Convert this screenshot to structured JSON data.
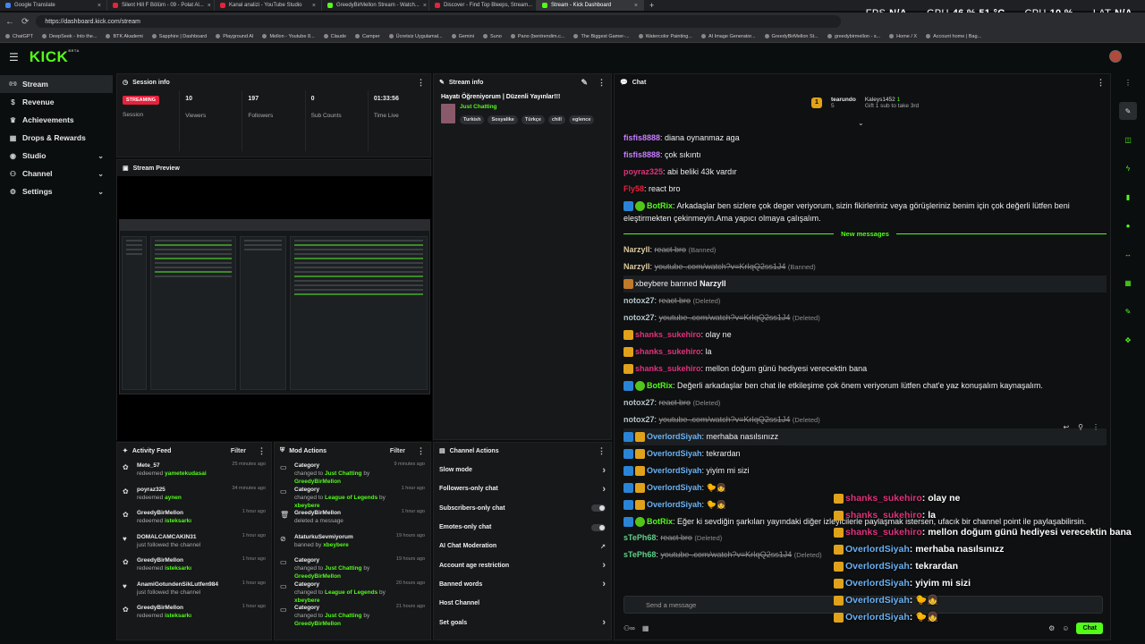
{
  "browser": {
    "tabs": [
      {
        "label": "Google Translate",
        "color": "#4285f4"
      },
      {
        "label": "Silent Hill F Bölüm - 09 - Polat Al...",
        "color": "#e8213d"
      },
      {
        "label": "Kanal analizi - YouTube Studio",
        "color": "#e8213d"
      },
      {
        "label": "GreedyBirMellon Stream - Watch...",
        "color": "#53fc18"
      },
      {
        "label": "Discover - Find Top Bleeps, Stream...",
        "color": "#e8213d"
      },
      {
        "label": "Stream - Kick Dashboard",
        "color": "#53fc18",
        "active": true
      }
    ],
    "new_tab": "+",
    "url": "https://dashboard.kick.com/stream",
    "bookmarks": [
      "ChatGPT",
      "DeepSeek - Into the...",
      "BTK Akademi",
      "Sapphire | Dashboard",
      "Playground AI",
      "Mellon - Youtube 8...",
      "Claude",
      "Camper",
      "Ücretsiz Uygulamal...",
      "Gemini",
      "Suno",
      "Pano (bentrendim.c...",
      "The Biggest Gamer-...",
      "Watercolor Painting...",
      "AI Image Generator...",
      "GreedyBirMellon St...",
      "greedybirmellon - s...",
      "Home / X",
      "Account home | Bag..."
    ]
  },
  "perf": {
    "fps_label": "FPS",
    "fps_value": "N/A",
    "gpu_label": "GPU",
    "gpu_value": "46 % 51 °C",
    "cpu_label": "CPU",
    "cpu_value": "10 %",
    "lat_label": "LAT",
    "lat_value": "N/A"
  },
  "header": {
    "logo": "KICK",
    "logo_beta": "BETA"
  },
  "sidebar": {
    "items": [
      {
        "label": "Stream",
        "icon": "broadcast-icon",
        "active": true
      },
      {
        "label": "Revenue",
        "icon": "dollar-icon"
      },
      {
        "label": "Achievements",
        "icon": "trophy-icon"
      },
      {
        "label": "Drops & Rewards",
        "icon": "gift-icon"
      },
      {
        "label": "Studio",
        "icon": "studio-icon",
        "chevron": true
      },
      {
        "label": "Channel",
        "icon": "user-icon",
        "chevron": true
      },
      {
        "label": "Settings",
        "icon": "gear-icon",
        "chevron": true
      }
    ]
  },
  "session": {
    "title": "Session info",
    "status": "STREAMING",
    "status_label": "Session",
    "viewers": "10",
    "viewers_label": "Viewers",
    "followers": "197",
    "followers_label": "Followers",
    "subs": "0",
    "subs_label": "Sub Counts",
    "time": "01:33:56",
    "time_label": "Time Live"
  },
  "stream_info": {
    "title": "Stream info",
    "stream_title": "Hayatı Öğreniyorum | Düzenli Yayınlar!!!",
    "category": "Just Chatting",
    "tags": [
      "Turkish",
      "Sosyalike",
      "Türkçe",
      "chill",
      "eglence"
    ]
  },
  "preview": {
    "title": "Stream Preview"
  },
  "activity": {
    "title": "Activity Feed",
    "filter": "Filter",
    "items": [
      {
        "name": "Mete_57",
        "sub": "redeemed",
        "sub_acc": "yametekudasai",
        "time": "25 minutes ago",
        "icon": "redeem-icon"
      },
      {
        "name": "poyraz325",
        "sub": "redeemed",
        "sub_acc": "aynen",
        "time": "34 minutes ago",
        "icon": "redeem-icon"
      },
      {
        "name": "GreedyBirMellon",
        "sub": "redeemed",
        "sub_acc": "isteksarkı",
        "time": "1 hour ago",
        "icon": "redeem-icon"
      },
      {
        "name": "DOMALCAMCAKIN31",
        "sub": "just followed the channel",
        "sub_acc": "",
        "time": "1 hour ago",
        "icon": "heart-icon"
      },
      {
        "name": "GreedyBirMellon",
        "sub": "redeemed",
        "sub_acc": "isteksarkı",
        "time": "1 hour ago",
        "icon": "redeem-icon"
      },
      {
        "name": "AnamiGotundenSikLutfen984",
        "sub": "just followed the channel",
        "sub_acc": "",
        "time": "1 hour ago",
        "icon": "heart-icon"
      },
      {
        "name": "GreedyBirMellon",
        "sub": "redeemed",
        "sub_acc": "isteksarkı",
        "time": "1 hour ago",
        "icon": "redeem-icon"
      }
    ]
  },
  "mod": {
    "title": "Mod Actions",
    "filter": "Filter",
    "items": [
      {
        "name": "Category",
        "pre": "changed to",
        "a1": "Just Chatting",
        "mid": "by",
        "a2": "GreedyBirMellon",
        "time": "9 minutes ago",
        "icon": "category-icon"
      },
      {
        "name": "Category",
        "pre": "changed to",
        "a1": "League of Legends",
        "mid": "by",
        "a2": "xbeybere",
        "time": "1 hour ago",
        "icon": "category-icon"
      },
      {
        "name": "GreedyBirMellon",
        "pre": "deleted a message",
        "a1": "",
        "mid": "",
        "a2": "",
        "time": "1 hour ago",
        "icon": "trash-icon"
      },
      {
        "name": "AtaturkuSevmiyorum",
        "pre": "banned by",
        "a1": "xbeybere",
        "mid": "",
        "a2": "",
        "time": "19 hours ago",
        "icon": "ban-icon"
      },
      {
        "name": "Category",
        "pre": "changed to",
        "a1": "Just Chatting",
        "mid": "by",
        "a2": "GreedyBirMellon",
        "time": "19 hours ago",
        "icon": "category-icon"
      },
      {
        "name": "Category",
        "pre": "changed to",
        "a1": "League of Legends",
        "mid": "by",
        "a2": "xbeybere",
        "time": "20 hours ago",
        "icon": "category-icon"
      },
      {
        "name": "Category",
        "pre": "changed to",
        "a1": "Just Chatting",
        "mid": "by",
        "a2": "GreedyBirMellon",
        "time": "21 hours ago",
        "icon": "category-icon"
      }
    ]
  },
  "channel_actions": {
    "title": "Channel Actions",
    "items": [
      {
        "label": "Slow mode",
        "type": "chevron"
      },
      {
        "label": "Followers-only chat",
        "type": "chevron"
      },
      {
        "label": "Subscribers-only chat",
        "type": "toggle"
      },
      {
        "label": "Emotes-only chat",
        "type": "toggle"
      },
      {
        "label": "AI Chat Moderation",
        "type": "external"
      },
      {
        "label": "Account age restriction",
        "type": "chevron"
      },
      {
        "label": "Banned words",
        "type": "chevron"
      },
      {
        "label": "Host Channel",
        "type": "none"
      },
      {
        "label": "Set goals",
        "type": "chevron"
      }
    ]
  },
  "chat": {
    "title": "Chat",
    "gifter": "tearundo",
    "gifter_count": "5",
    "top2": "Kaleys1452",
    "top2_count": "1",
    "gift_text": "Gift 1 sub to take 3rd",
    "new_messages": "New messages",
    "input_placeholder": "Send a message",
    "send": "Chat",
    "messages": [
      {
        "user": "fisfis8888",
        "color": "#c77dff",
        "text": ": diana oynanmaz aga"
      },
      {
        "user": "fisfis8888",
        "color": "#c77dff",
        "text": ": çok sıkıntı"
      },
      {
        "user": "poyraz325",
        "color": "#e0327d",
        "text": ": abi beliki 43k vardır"
      },
      {
        "user": "Fly58",
        "color": "#e8213d",
        "text": ": react bro"
      },
      {
        "user": "BotRix",
        "color": "#53fc18",
        "icons": [
          "bot",
          "ver"
        ],
        "multi": true,
        "text": ": Arkadaşlar ben sizlere çok deger veriyorum, sizin fikirleriniz veya görüşleriniz benim için çok değerli lütfen beni eleştirmekten çekinmeyin.Ama yapıcı olmaya çalışalım."
      },
      {
        "divider": true
      },
      {
        "user": "Narzyll",
        "color": "#ddc9a0",
        "del": "react bro",
        "note": "(Banned)"
      },
      {
        "user": "Narzyll",
        "color": "#ddc9a0",
        "del": "youtube .com/watch?v=KrIqQ2ss1J4",
        "note": "(Banned)"
      },
      {
        "system": true,
        "pre": "xbeybere",
        "mid": " banned ",
        "post": "Narzyll"
      },
      {
        "user": "notox27",
        "color": "#b6c4c8",
        "del": "react bro",
        "note": "(Deleted)"
      },
      {
        "user": "notox27",
        "color": "#b6c4c8",
        "del": "youtube .com/watch?v=KrIqQ2ss1J4",
        "note": "(Deleted)"
      },
      {
        "user": "shanks_sukehiro",
        "color": "#e0327d",
        "icons": [
          "crown"
        ],
        "text": ": olay ne"
      },
      {
        "user": "shanks_sukehiro",
        "color": "#e0327d",
        "icons": [
          "crown"
        ],
        "text": ": la"
      },
      {
        "user": "shanks_sukehiro",
        "color": "#e0327d",
        "icons": [
          "crown"
        ],
        "text": ": mellon doğum günü hediyesi verecektin bana"
      },
      {
        "user": "BotRix",
        "color": "#53fc18",
        "icons": [
          "bot",
          "ver"
        ],
        "text": ": Değerli arkadaşlar ben chat ile etkileşime çok önem veriyorum lütfen chat'e yaz konuşalım kaynaşalım."
      },
      {
        "user": "notox27",
        "color": "#b6c4c8",
        "del": "react bro",
        "note": "(Deleted)"
      },
      {
        "user": "notox27",
        "color": "#b6c4c8",
        "del": "youtube .com/watch?v=KrIqQ2ss1J4",
        "note": "(Deleted)"
      },
      {
        "user": "OverlordSiyah",
        "color": "#6ab0f3",
        "icons": [
          "bot",
          "crown"
        ],
        "text": ": merhaba nasılsınızz",
        "hl": true
      },
      {
        "user": "OverlordSiyah",
        "color": "#6ab0f3",
        "icons": [
          "bot",
          "crown"
        ],
        "text": ": tekrardan"
      },
      {
        "user": "OverlordSiyah",
        "color": "#6ab0f3",
        "icons": [
          "bot",
          "crown"
        ],
        "text": ": yiyim mi sizi"
      },
      {
        "user": "OverlordSiyah",
        "color": "#6ab0f3",
        "icons": [
          "bot",
          "crown"
        ],
        "text": ": 🐤👧"
      },
      {
        "user": "OverlordSiyah",
        "color": "#6ab0f3",
        "icons": [
          "bot",
          "crown"
        ],
        "text": ": 🐤👧"
      },
      {
        "user": "BotRix",
        "color": "#53fc18",
        "icons": [
          "bot",
          "ver"
        ],
        "multi": true,
        "text": ": Eğer ki sevdiğin şarkıları yayındaki diğer izleyicilerle paylaşmak istersen, ufacık bir channel point ile paylaşabilirsin."
      },
      {
        "user": "sTePh68",
        "color": "#5fd08a",
        "del": "react bro",
        "note": "(Deleted)"
      },
      {
        "user": "sTePh68",
        "color": "#5fd08a",
        "del": "youtube .com/watch?v=KrIqQ2ss1J4",
        "note": "(Deleted)"
      }
    ]
  },
  "overlay": [
    {
      "user": "shanks_sukehiro",
      "color": "#e0327d",
      "text": ": olay ne"
    },
    {
      "user": "shanks_sukehiro",
      "color": "#e0327d",
      "text": ": la"
    },
    {
      "user": "shanks_sukehiro",
      "color": "#e0327d",
      "text": ": mellon doğum günü hediyesi verecektin bana"
    },
    {
      "user": "OverlordSiyah",
      "color": "#6ab0f3",
      "text": ": merhaba nasılsınızz"
    },
    {
      "user": "OverlordSiyah",
      "color": "#6ab0f3",
      "text": ": tekrardan"
    },
    {
      "user": "OverlordSiyah",
      "color": "#6ab0f3",
      "text": ": yiyim mi sizi"
    },
    {
      "user": "OverlordSiyah",
      "color": "#6ab0f3",
      "text": ": 🐤👧"
    },
    {
      "user": "OverlordSiyah",
      "color": "#6ab0f3",
      "text": ": 🐤👧"
    }
  ],
  "colors": {
    "accent": "#53fc18",
    "live": "#e8213d",
    "panel": "#16181a"
  }
}
